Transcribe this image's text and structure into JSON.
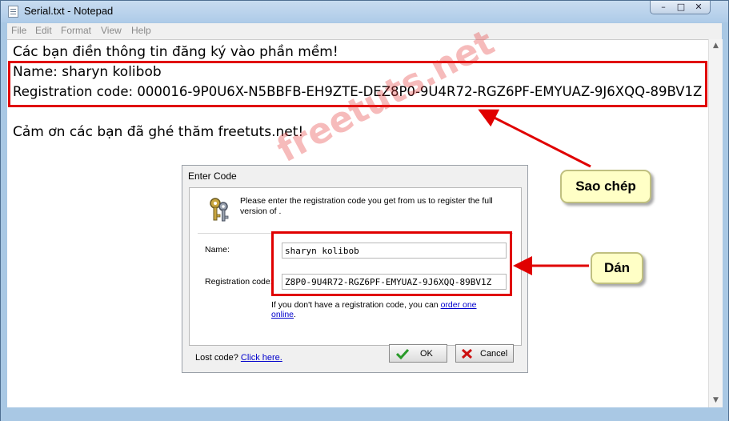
{
  "window": {
    "title": "Serial.txt - Notepad",
    "controls": {
      "minimize": "–",
      "maximize": "□",
      "close": "✕"
    }
  },
  "menu": [
    "File",
    "Edit",
    "Format",
    "View",
    "Help"
  ],
  "document": {
    "line1": "Các bạn điền thông tin đăng ký vào phần mềm!",
    "line2": "Name: sharyn kolibob",
    "line3": "Registration code: 000016-9P0U6X-N5BBFB-EH9ZTE-DEZ8P0-9U4R72-RGZ6PF-EMYUAZ-9J6XQQ-89BV1Z",
    "line4": "Cảm ơn các bạn đã ghé thăm freetuts.net!"
  },
  "dialog": {
    "title": "Enter Code",
    "info": "Please enter the registration code you get from us to register the full version of .",
    "name_label": "Name:",
    "name_value": "sharyn kolibob",
    "code_label": "Registration code:",
    "code_value": "Z8P0-9U4R72-RGZ6PF-EMYUAZ-9J6XQQ-89BV1Z",
    "help_prefix": "If you don't have a registration code, you can ",
    "help_link_1": "order one",
    "help_link_2": "online",
    "help_suffix": ".",
    "lost_prefix": "Lost code? ",
    "lost_link": "Click here.",
    "ok_label": "OK",
    "cancel_label": "Cancel"
  },
  "annotations": {
    "copy_callout": "Sao chép",
    "paste_callout": "Dán",
    "watermark": "freetuts.net"
  },
  "colors": {
    "highlight_red": "#e00000",
    "callout_fill": "#ffffc6",
    "ok_check": "#2a9a2a",
    "cancel_x": "#cc1111",
    "link": "#0000cc"
  }
}
